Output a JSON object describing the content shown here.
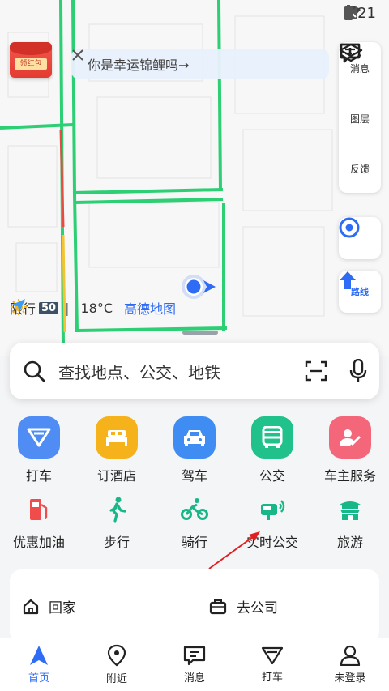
{
  "status_bar": {
    "time": "5:21"
  },
  "red_packet": {
    "label": "领红包"
  },
  "banner": {
    "text": "你是幸运锦鲤吗→"
  },
  "map_tools": [
    {
      "label": "消息",
      "icon": "message-icon"
    },
    {
      "label": "图层",
      "icon": "layers-icon"
    },
    {
      "label": "反馈",
      "icon": "feedback-icon"
    }
  ],
  "route_button": {
    "label": "路线"
  },
  "map_info": {
    "limit_label": "限行",
    "limit_number": "50",
    "temperature": "18°C",
    "brand": "高德地图"
  },
  "search": {
    "placeholder": "查找地点、公交、地铁"
  },
  "services_row1": [
    {
      "label": "打车",
      "icon": "taxi-icon",
      "color": "#4f8df5"
    },
    {
      "label": "订酒店",
      "icon": "hotel-icon",
      "color": "#f6b21b"
    },
    {
      "label": "驾车",
      "icon": "car-icon",
      "color": "#3f8cf3"
    },
    {
      "label": "公交",
      "icon": "bus-icon",
      "color": "#21c18b"
    },
    {
      "label": "车主服务",
      "icon": "owner-service-icon",
      "color": "#f4677a"
    }
  ],
  "services_row2": [
    {
      "label": "优惠加油",
      "icon": "fuel-icon",
      "color": "#f04c4c"
    },
    {
      "label": "步行",
      "icon": "walk-icon",
      "color": "#17b787"
    },
    {
      "label": "骑行",
      "icon": "bike-icon",
      "color": "#17b787"
    },
    {
      "label": "实时公交",
      "icon": "realtime-bus-icon",
      "color": "#17b787"
    },
    {
      "label": "旅游",
      "icon": "travel-icon",
      "color": "#17b787"
    }
  ],
  "shortcuts": {
    "home": "回家",
    "work": "去公司"
  },
  "tabs": [
    {
      "label": "首页",
      "icon": "home-nav-icon",
      "active": true
    },
    {
      "label": "附近",
      "icon": "nearby-icon",
      "active": false
    },
    {
      "label": "消息",
      "icon": "message-nav-icon",
      "active": false
    },
    {
      "label": "打车",
      "icon": "taxi-nav-icon",
      "active": false
    },
    {
      "label": "未登录",
      "icon": "user-icon",
      "active": false
    }
  ],
  "colors": {
    "accent": "#2f6cf6",
    "road_green": "#2ccf73",
    "road_red": "#e54d42"
  }
}
